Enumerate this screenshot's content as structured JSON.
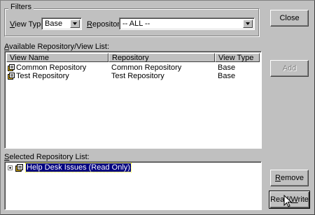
{
  "filters": {
    "title": "Filters",
    "view_type": {
      "label_u": "V",
      "label_rest": "iew Type:",
      "value": "Base"
    },
    "repository": {
      "label_u": "R",
      "label_rest": "epository:",
      "value": "-- ALL --"
    }
  },
  "available": {
    "label_prefix": "",
    "label_u": "A",
    "label_rest": "vailable Repository/View List:",
    "columns": [
      "View Name",
      "Repository",
      "View Type"
    ],
    "rows": [
      {
        "name": "Common Repository",
        "repository": "Common Repository",
        "type": "Base"
      },
      {
        "name": "Test Repository",
        "repository": "Test Repository",
        "type": "Base"
      }
    ]
  },
  "selected": {
    "label_u": "S",
    "label_rest": "elected Repository List:",
    "item": "Help Desk Issues (Read Only)"
  },
  "buttons": {
    "close": "Close",
    "add": "Add",
    "remove_u": "R",
    "remove_rest": "emove",
    "readwrite_pre": "Read/",
    "readwrite_u": "W",
    "readwrite_rest": "rite"
  },
  "colors": {
    "face": "#c0c0c0",
    "selection": "#000080",
    "icon_yellow": "#f0c000"
  }
}
